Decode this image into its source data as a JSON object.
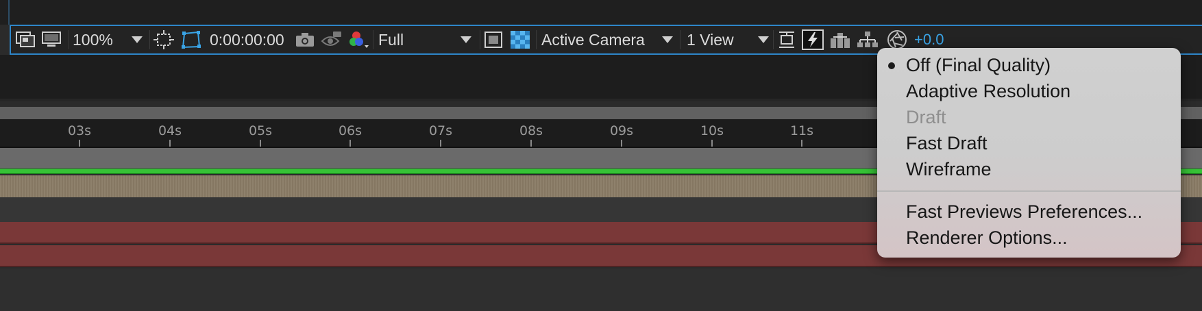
{
  "toolbar": {
    "zoom": "100%",
    "timecode": "0:00:00:00",
    "resolution": "Full",
    "camera": "Active Camera",
    "views": "1 View",
    "exposure": "+0.0"
  },
  "timeline": {
    "ticks": [
      "03s",
      "04s",
      "05s",
      "06s",
      "07s",
      "08s",
      "09s",
      "10s",
      "11s"
    ]
  },
  "fast_previews_menu": {
    "items": [
      {
        "label": "Off (Final Quality)",
        "checked": true,
        "enabled": true
      },
      {
        "label": "Adaptive Resolution",
        "checked": false,
        "enabled": true
      },
      {
        "label": "Draft",
        "checked": false,
        "enabled": false
      },
      {
        "label": "Fast Draft",
        "checked": false,
        "enabled": true
      },
      {
        "label": "Wireframe",
        "checked": false,
        "enabled": true
      },
      {
        "label": "Fast Previews Preferences...",
        "checked": false,
        "enabled": true
      },
      {
        "label": "Renderer Options...",
        "checked": false,
        "enabled": true
      }
    ]
  },
  "colors": {
    "accent": "#3aa4e6",
    "timebar_green": "#36c236",
    "layer_red": "#7a3838",
    "layer_tan": "#8a7c66"
  }
}
